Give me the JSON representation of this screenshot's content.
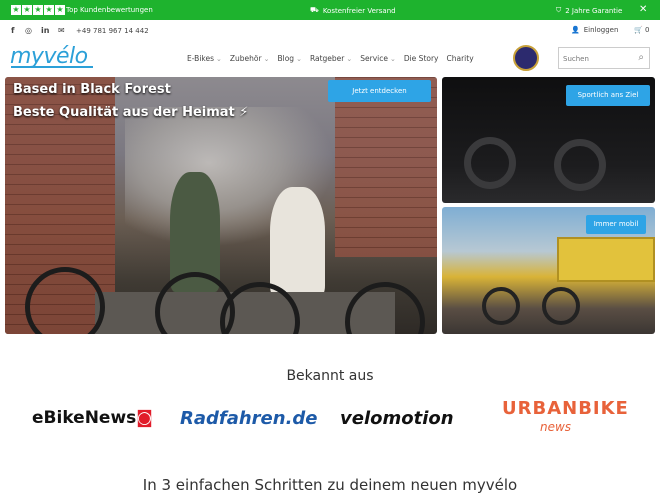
{
  "topbar": {
    "reviews": "Top Kundenbewertungen",
    "shipping": "Kostenfreier Versand",
    "warranty": "2 Jahre Garantie",
    "bg_color": "#1eb32e"
  },
  "contact": {
    "phone": "+49 781 967 14 442",
    "login": "Einloggen",
    "cart_count": "0"
  },
  "logo": "myvélo",
  "nav": {
    "items": [
      "E-Bikes",
      "Zubehör",
      "Blog",
      "Ratgeber",
      "Service",
      "Die Story",
      "Charity"
    ]
  },
  "search": {
    "placeholder": "Suchen"
  },
  "hero": {
    "line1": "Based in Black Forest",
    "line2": "Beste Qualität aus der Heimat ⚡",
    "cta": "Jetzt entdecken"
  },
  "side1": {
    "cta": "Sportlich ans Ziel"
  },
  "side2": {
    "cta": "Immer mobil"
  },
  "press": {
    "heading": "Bekannt aus",
    "logos": [
      "eBikeNews",
      "Radfahren.de",
      "velomotion",
      "URBANBIKE",
      "news"
    ]
  },
  "steps_heading": "In 3 einfachen Schritten zu deinem neuen myvélo",
  "accent_color": "#2ea4e6"
}
